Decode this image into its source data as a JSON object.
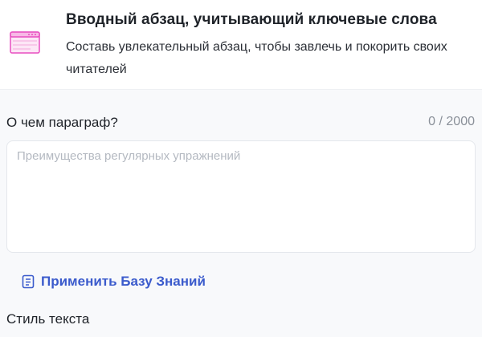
{
  "header": {
    "icon": "browser-window-icon",
    "title": "Вводный абзац, учитывающий ключевые слова",
    "description": "Составь увлекательный абзац, чтобы завлечь и покорить своих читателей"
  },
  "form": {
    "topic_label": "О чем параграф?",
    "counter": "0 / 2000",
    "topic_placeholder": "Преимущества регулярных упражнений",
    "topic_value": "",
    "knowledge_base_icon": "book-icon",
    "knowledge_base_label": "Применить Базу Знаний",
    "style_label": "Стиль текста"
  },
  "colors": {
    "accent": "#3b5bcc",
    "icon_pink": "#e84fc0",
    "icon_pink_light": "#fde6f6"
  }
}
